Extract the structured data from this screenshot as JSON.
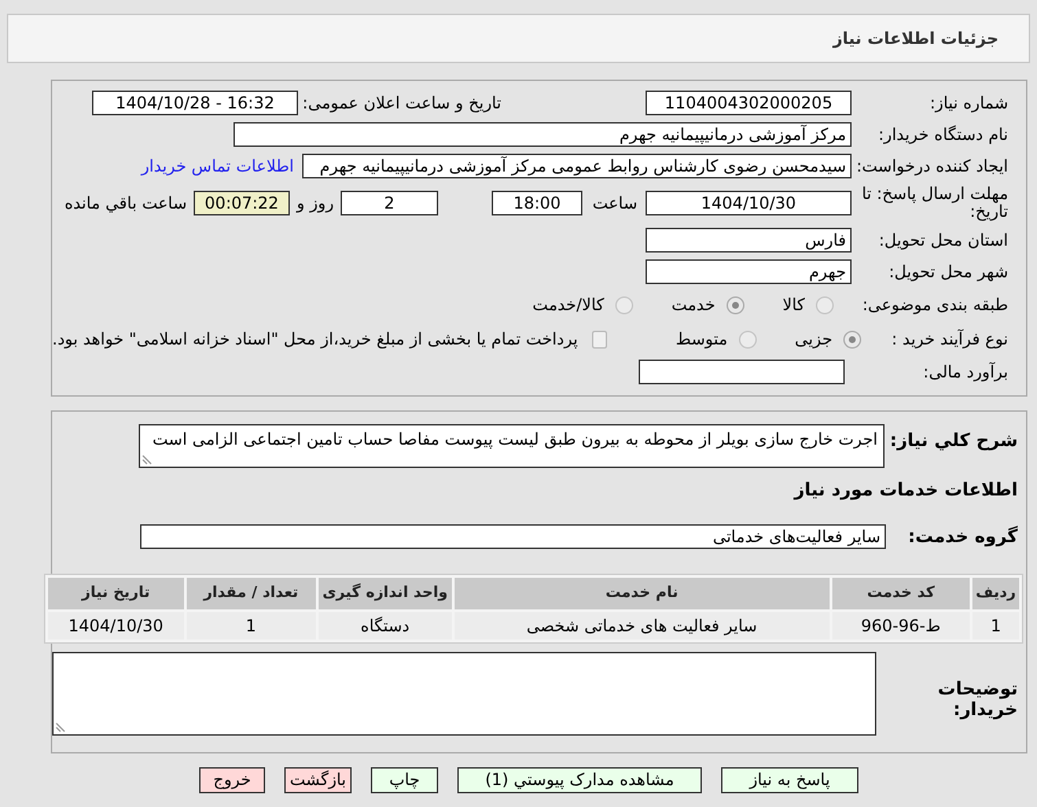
{
  "header": {
    "title": "جزئیات اطلاعات نیاز"
  },
  "need": {
    "number": {
      "label": "شماره نیاز:",
      "value": "1104004302000205"
    },
    "announce": {
      "label": "تاریخ و ساعت اعلان عمومی:",
      "value": "1404/10/28 - 16:32"
    },
    "buyer": {
      "label": "نام دستگاه خریدار:",
      "value": "مرکز آموزشی درمانیپیمانیه جهرم"
    },
    "creator": {
      "label": "ایجاد کننده درخواست:",
      "value": "سیدمحسن رضوی کارشناس روابط عمومی مرکز آموزشی درمانیپیمانیه جهرم",
      "link": "اطلاعات تماس خریدار"
    },
    "deadline": {
      "label": "مهلت ارسال پاسخ: تا تاریخ:",
      "date": "1404/10/30",
      "time_label": "ساعت",
      "time": "18:00",
      "days": "2",
      "days_label": "روز و",
      "remaining": "00:07:22",
      "remaining_label": "ساعت باقي مانده"
    },
    "province": {
      "label": "استان محل تحویل:",
      "value": "فارس"
    },
    "city": {
      "label": "شهر محل تحویل:",
      "value": "جهرم"
    },
    "category": {
      "label": "طبقه بندی موضوعی:",
      "options": [
        {
          "label": "کالا",
          "selected": false
        },
        {
          "label": "خدمت",
          "selected": true
        },
        {
          "label": "کالا/خدمت",
          "selected": false
        }
      ]
    },
    "process": {
      "label": "نوع فرآیند خرید :",
      "options": [
        {
          "label": "جزیی",
          "selected": true
        },
        {
          "label": "متوسط",
          "selected": false
        }
      ],
      "payment": {
        "label": "پرداخت تمام یا بخشی از مبلغ خرید،از محل \"اسناد خزانه اسلامی\" خواهد بود.",
        "checked": false
      }
    },
    "estimate": {
      "label": "برآورد مالی:"
    }
  },
  "description": {
    "label": "شرح کلي نیاز:",
    "value": "اجرت خارج سازی بویلر  از محوطه به بیرون  طبق  لیست پیوست  مفاصا حساب تامین اجتماعی  الزامی است"
  },
  "services": {
    "title": "اطلاعات خدمات مورد نیاز",
    "group": {
      "label": "گروه خدمت:",
      "value": "سایر فعالیت‌های خدماتی"
    },
    "table": {
      "columns": [
        "ردیف",
        "کد خدمت",
        "نام خدمت",
        "واحد اندازه گیری",
        "تعداد / مقدار",
        "تاریخ نیاز"
      ],
      "rows": [
        [
          "1",
          "ط-96-960",
          "سایر فعالیت های خدماتی شخصی",
          "دستگاه",
          "1",
          "1404/10/30"
        ]
      ]
    },
    "notes": {
      "label": "توضیحات خریدار:"
    }
  },
  "buttons": [
    {
      "label": "پاسخ به نیاز",
      "kind": "primary"
    },
    {
      "label": "مشاهده مدارک پیوستي (1)",
      "kind": "primary"
    },
    {
      "label": "چاپ",
      "kind": "primary"
    },
    {
      "label": "بازگشت",
      "kind": "danger"
    },
    {
      "label": "خروج",
      "kind": "danger"
    }
  ]
}
